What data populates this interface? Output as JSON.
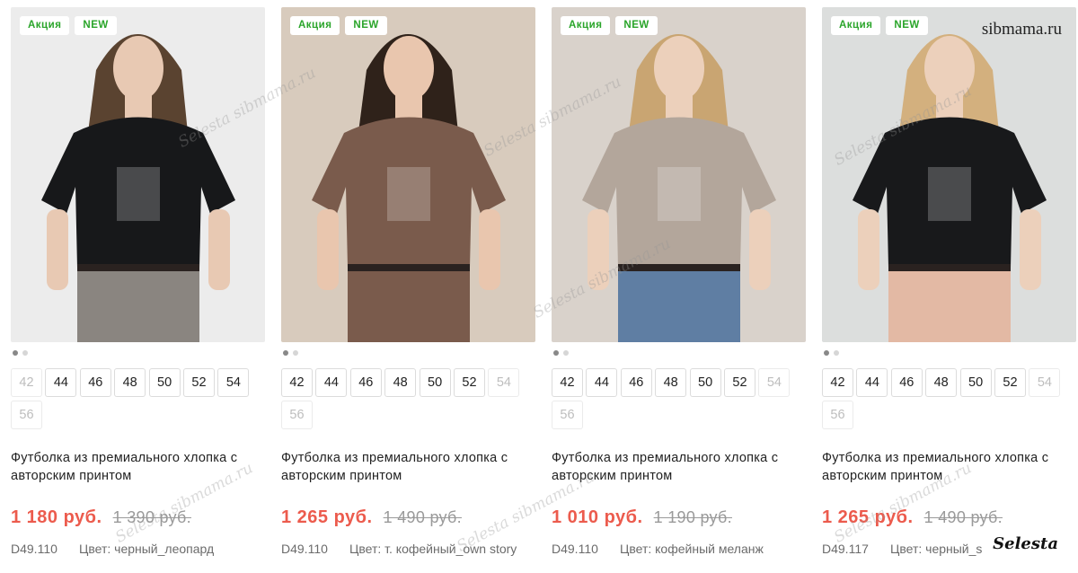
{
  "site_watermark": "sibmama.ru",
  "brand_watermark": "Selesta",
  "products": [
    {
      "badges": [
        "Акция",
        "NEW"
      ],
      "sizes": [
        {
          "label": "42",
          "available": false
        },
        {
          "label": "44",
          "available": true
        },
        {
          "label": "46",
          "available": true
        },
        {
          "label": "48",
          "available": true
        },
        {
          "label": "50",
          "available": true
        },
        {
          "label": "52",
          "available": true
        },
        {
          "label": "54",
          "available": true
        },
        {
          "label": "56",
          "available": false
        }
      ],
      "title": "Футболка из премиального хлопка с авторским принтом",
      "price": "1 180 руб.",
      "old_price": "1 390 руб.",
      "sku": "D49.110",
      "color": "Цвет: черный_леопард",
      "image": {
        "bg": "#ececec",
        "shirt": "#17181a",
        "pants": "#8a8580",
        "hair": "#5a4330",
        "skin": "#e8c9b3"
      }
    },
    {
      "badges": [
        "Акция",
        "NEW"
      ],
      "sizes": [
        {
          "label": "42",
          "available": true
        },
        {
          "label": "44",
          "available": true
        },
        {
          "label": "46",
          "available": true
        },
        {
          "label": "48",
          "available": true
        },
        {
          "label": "50",
          "available": true
        },
        {
          "label": "52",
          "available": true
        },
        {
          "label": "54",
          "available": false
        },
        {
          "label": "56",
          "available": false
        }
      ],
      "title": "Футболка из премиального хлопка с авторским принтом",
      "price": "1 265 руб.",
      "old_price": "1 490 руб.",
      "sku": "D49.110",
      "color": "Цвет: т. кофейный_own story",
      "image": {
        "bg": "#d8cbbd",
        "shirt": "#7a5b4c",
        "pants": "#7a5b4c",
        "hair": "#2f221a",
        "skin": "#e9c6ae"
      }
    },
    {
      "badges": [
        "Акция",
        "NEW"
      ],
      "sizes": [
        {
          "label": "42",
          "available": true
        },
        {
          "label": "44",
          "available": true
        },
        {
          "label": "46",
          "available": true
        },
        {
          "label": "48",
          "available": true
        },
        {
          "label": "50",
          "available": true
        },
        {
          "label": "52",
          "available": true
        },
        {
          "label": "54",
          "available": false
        },
        {
          "label": "56",
          "available": false
        }
      ],
      "title": "Футболка из премиального хлопка с авторским принтом",
      "price": "1 010 руб.",
      "old_price": "1 190 руб.",
      "sku": "D49.110",
      "color": "Цвет: кофейный меланж",
      "image": {
        "bg": "#d9d2cb",
        "shirt": "#b3a69b",
        "pants": "#5f7ea3",
        "hair": "#c9a572",
        "skin": "#ecd0bb"
      }
    },
    {
      "badges": [
        "Акция",
        "NEW"
      ],
      "sizes": [
        {
          "label": "42",
          "available": true
        },
        {
          "label": "44",
          "available": true
        },
        {
          "label": "46",
          "available": true
        },
        {
          "label": "48",
          "available": true
        },
        {
          "label": "50",
          "available": true
        },
        {
          "label": "52",
          "available": true
        },
        {
          "label": "54",
          "available": false
        },
        {
          "label": "56",
          "available": false
        }
      ],
      "title": "Футболка из премиального хлопка с авторским принтом",
      "price": "1 265 руб.",
      "old_price": "1 490 руб.",
      "sku": "D49.117",
      "color": "Цвет: черный_s",
      "image": {
        "bg": "#dcdedd",
        "shirt": "#18191b",
        "pants": "#e3b9a4",
        "hair": "#d3b07e",
        "skin": "#ecd0bb"
      }
    }
  ]
}
